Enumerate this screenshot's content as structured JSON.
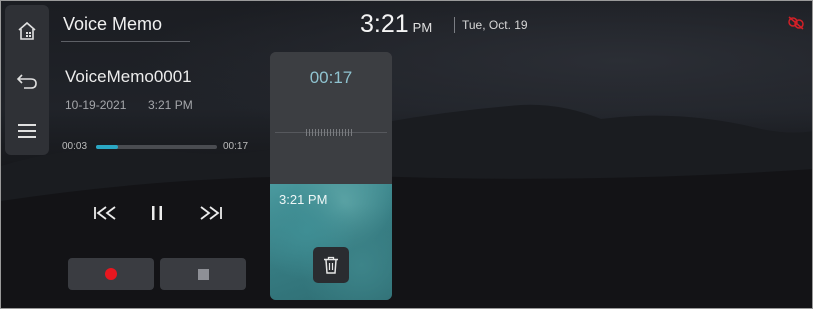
{
  "header": {
    "app_title": "Voice Memo",
    "time": "3:21",
    "ampm": "PM",
    "date": "Tue, Oct. 19"
  },
  "sidebar": {
    "items": [
      {
        "icon": "home-icon"
      },
      {
        "icon": "back-icon"
      },
      {
        "icon": "menu-icon"
      }
    ]
  },
  "memo": {
    "name": "VoiceMemo0001",
    "date": "10-19-2021",
    "time": "3:21 PM"
  },
  "playback": {
    "elapsed": "00:03",
    "total": "00:17",
    "progress_fraction": 0.18
  },
  "controls": [
    "skip-previous-icon",
    "pause-icon",
    "skip-next-icon"
  ],
  "record_panel": {
    "timer": "00:17",
    "timestamp": "3:21 PM"
  },
  "colors": {
    "accent": "#2aa7c4",
    "record": "#e8171f",
    "status_warning": "#d22027"
  }
}
